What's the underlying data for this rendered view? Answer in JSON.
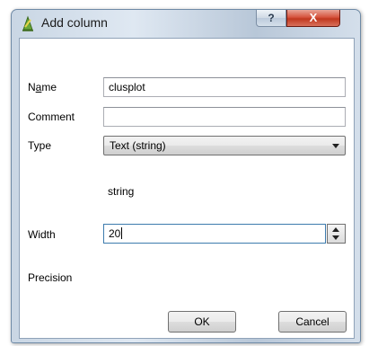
{
  "window": {
    "title": "Add column",
    "help_label": "?",
    "close_label": "X"
  },
  "form": {
    "name_label": "Name",
    "name_label_parts": [
      "N",
      "a",
      "me"
    ],
    "name_value": "clusplot",
    "comment_label": "Comment",
    "comment_value": "",
    "type_label": "Type",
    "type_value": "Text (string)",
    "type_name": "string",
    "width_label": "Width",
    "width_value": "20",
    "precision_label": "Precision"
  },
  "buttons": {
    "ok_label": "OK",
    "cancel_label": "Cancel"
  },
  "colors": {
    "title_bar": "#c9d6e4",
    "close_button": "#c0381f",
    "focus_border": "#3d7bad"
  }
}
